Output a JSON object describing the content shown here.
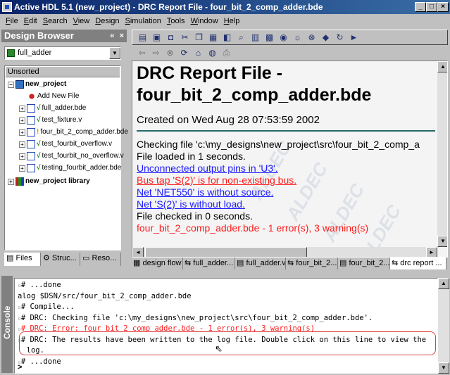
{
  "window": {
    "title": "Active HDL 5.1 (new_project) - DRC Report File - four_bit_2_comp_adder.bde",
    "controls": [
      "_",
      "□",
      "×"
    ]
  },
  "menu": [
    "File",
    "Edit",
    "Search",
    "View",
    "Design",
    "Simulation",
    "Tools",
    "Window",
    "Help"
  ],
  "left_panel": {
    "title": "Design Browser",
    "header_buttons": "« ×",
    "design_select": "full_adder",
    "tree_header": "Unsorted",
    "tree": [
      {
        "label": "new_project",
        "bold": true
      },
      {
        "label": "Add New File"
      },
      {
        "label": "full_adder.bde"
      },
      {
        "label": "test_fixture.v"
      },
      {
        "label": "four_bit_2_comp_adder.bde"
      },
      {
        "label": "test_fourbit_overflow.v"
      },
      {
        "label": "test_fourbit_no_overflow.v"
      },
      {
        "label": "testing_fourbit_adder.bde"
      },
      {
        "label": "new_project library",
        "bold": true
      }
    ],
    "tabs": [
      "Files",
      "Struc...",
      "Reso..."
    ]
  },
  "report": {
    "title": "DRC Report File - four_bit_2_comp_adder.bde",
    "created": "Created on Wed Aug 28 07:53:59 2002",
    "lines": [
      {
        "text": "Checking file 'c:\\my_designs\\new_project\\src\\four_bit_2_comp_a",
        "style": "normal"
      },
      {
        "text": "File loaded in 1 seconds.",
        "style": "normal"
      },
      {
        "text": "Unconnected output pins in 'U3'.",
        "style": "blue"
      },
      {
        "text": "Bus tap 'S(2)' is for non-existing bus.",
        "style": "redu"
      },
      {
        "text": "Net 'NET550' is without source.",
        "style": "blue"
      },
      {
        "text": "Net 'S(2)' is without load.",
        "style": "blue"
      },
      {
        "text": "File checked in 0 seconds.",
        "style": "normal"
      },
      {
        "text": "four_bit_2_comp_adder.bde - 1 error(s), 3 warning(s)",
        "style": "red"
      }
    ]
  },
  "doc_tabs": [
    "design flow",
    "full_adder...",
    "full_adder.v",
    "four_bit_2...",
    "four_bit_2...",
    "drc report ..."
  ],
  "console": {
    "side_label": "Console",
    "lines": [
      {
        "text": "# ...done",
        "style": "normal"
      },
      {
        "text": "alog $DSN/src/four_bit_2_comp_adder.bde",
        "style": "cmd"
      },
      {
        "text": "# Compile...",
        "style": "normal"
      },
      {
        "text": "# DRC: Checking file 'c:\\my_designs\\new_project\\src\\four_bit_2_comp_adder.bde'.",
        "style": "normal"
      },
      {
        "text": "# DRC: Error: four bit 2 comp adder.bde - 1 error(s), 3 warning(s)",
        "style": "red"
      },
      {
        "text": "# DRC: The results have been written to the log file. Double click on this line to view the",
        "style": "normal"
      },
      {
        "text": "  log.",
        "style": "cont"
      },
      {
        "text": "# ...done",
        "style": "normal"
      }
    ],
    "prompt": ">"
  },
  "colors": {
    "title_bar": "#0a246a",
    "link_blue": "#1a1aff",
    "error_red": "#ff1a1a",
    "highlight": "#e04040"
  }
}
